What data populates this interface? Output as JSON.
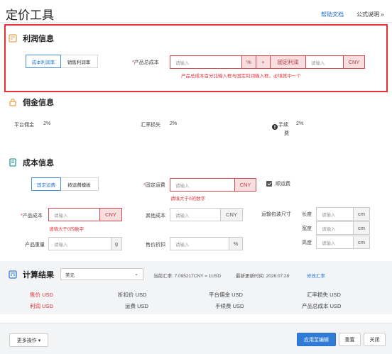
{
  "header": {
    "title": "定价工具",
    "help_link": "帮助文档",
    "formula_link": "公式说明 »"
  },
  "profit": {
    "section_title": "利润信息",
    "tab_cost_margin": "成本利润率",
    "tab_sale_margin": "销售利润率",
    "total_cost_label": "产品总成本",
    "percent_input_placeholder": "请输入",
    "percent_addon": "%",
    "plus_sign": "+",
    "fixed_profit_addon": "固定利润",
    "fixed_input_placeholder": "请输入",
    "currency_addon": "CNY",
    "error_text": "产品总成本百分比输入框与固定利润输入框，必填其中一个"
  },
  "commission": {
    "section_title": "佣金信息",
    "platform_label": "平台佣金",
    "platform_value": "2%",
    "exchange_loss_label": "汇率损失",
    "exchange_loss_value": "2%",
    "fee_label_1": "手续",
    "fee_label_2": "费",
    "fee_value": "2%"
  },
  "cost": {
    "section_title": "成本信息",
    "tab_fixed_shipping": "固定运费",
    "tab_template": "按运费模板",
    "fixed_shipping_label": "固定运费",
    "fixed_shipping_placeholder": "请输入",
    "fixed_shipping_addon": "CNY",
    "fixed_shipping_error": "请填大于0的数字",
    "include_shipping_label": "顺运费",
    "product_cost_label": "产品成本",
    "product_cost_placeholder": "请输入",
    "product_cost_addon": "CNY",
    "product_cost_error": "请填大于0的数字",
    "other_cost_label": "其他成本",
    "other_cost_placeholder": "请输入",
    "other_cost_addon": "CNY",
    "package_label": "运输包装尺寸",
    "length_label": "长度",
    "width_label": "宽度",
    "height_label": "高度",
    "dim_placeholder": "请输入",
    "dim_unit": "cm",
    "weight_label": "产品重量",
    "weight_placeholder": "请输入",
    "weight_unit": "g",
    "discount_label": "售价折扣",
    "discount_placeholder": "请输入",
    "discount_unit": "%"
  },
  "result": {
    "section_title": "计算结果",
    "currency_select": "美元",
    "rate_text": "当前汇率: 7.095217CNY = 1USD",
    "updated_text": "最新更新时间: 2026.07.28",
    "edit_rate_link": "修改汇率",
    "row1": [
      "售价 USD",
      "折扣价 USD",
      "平台佣金 USD",
      "汇率损失 USD"
    ],
    "row2": [
      "利润 USD",
      "运费 USD",
      "手续费 USD",
      "产品总成本 USD"
    ]
  },
  "footer": {
    "more_actions": "更多操作 ▾",
    "apply_button": "应用至编辑",
    "reset_button": "重置",
    "close_button": "关闭"
  },
  "colors": {
    "accent": "#2f7bd6",
    "error": "#e5323a",
    "section_icon": "#e8a24a"
  }
}
